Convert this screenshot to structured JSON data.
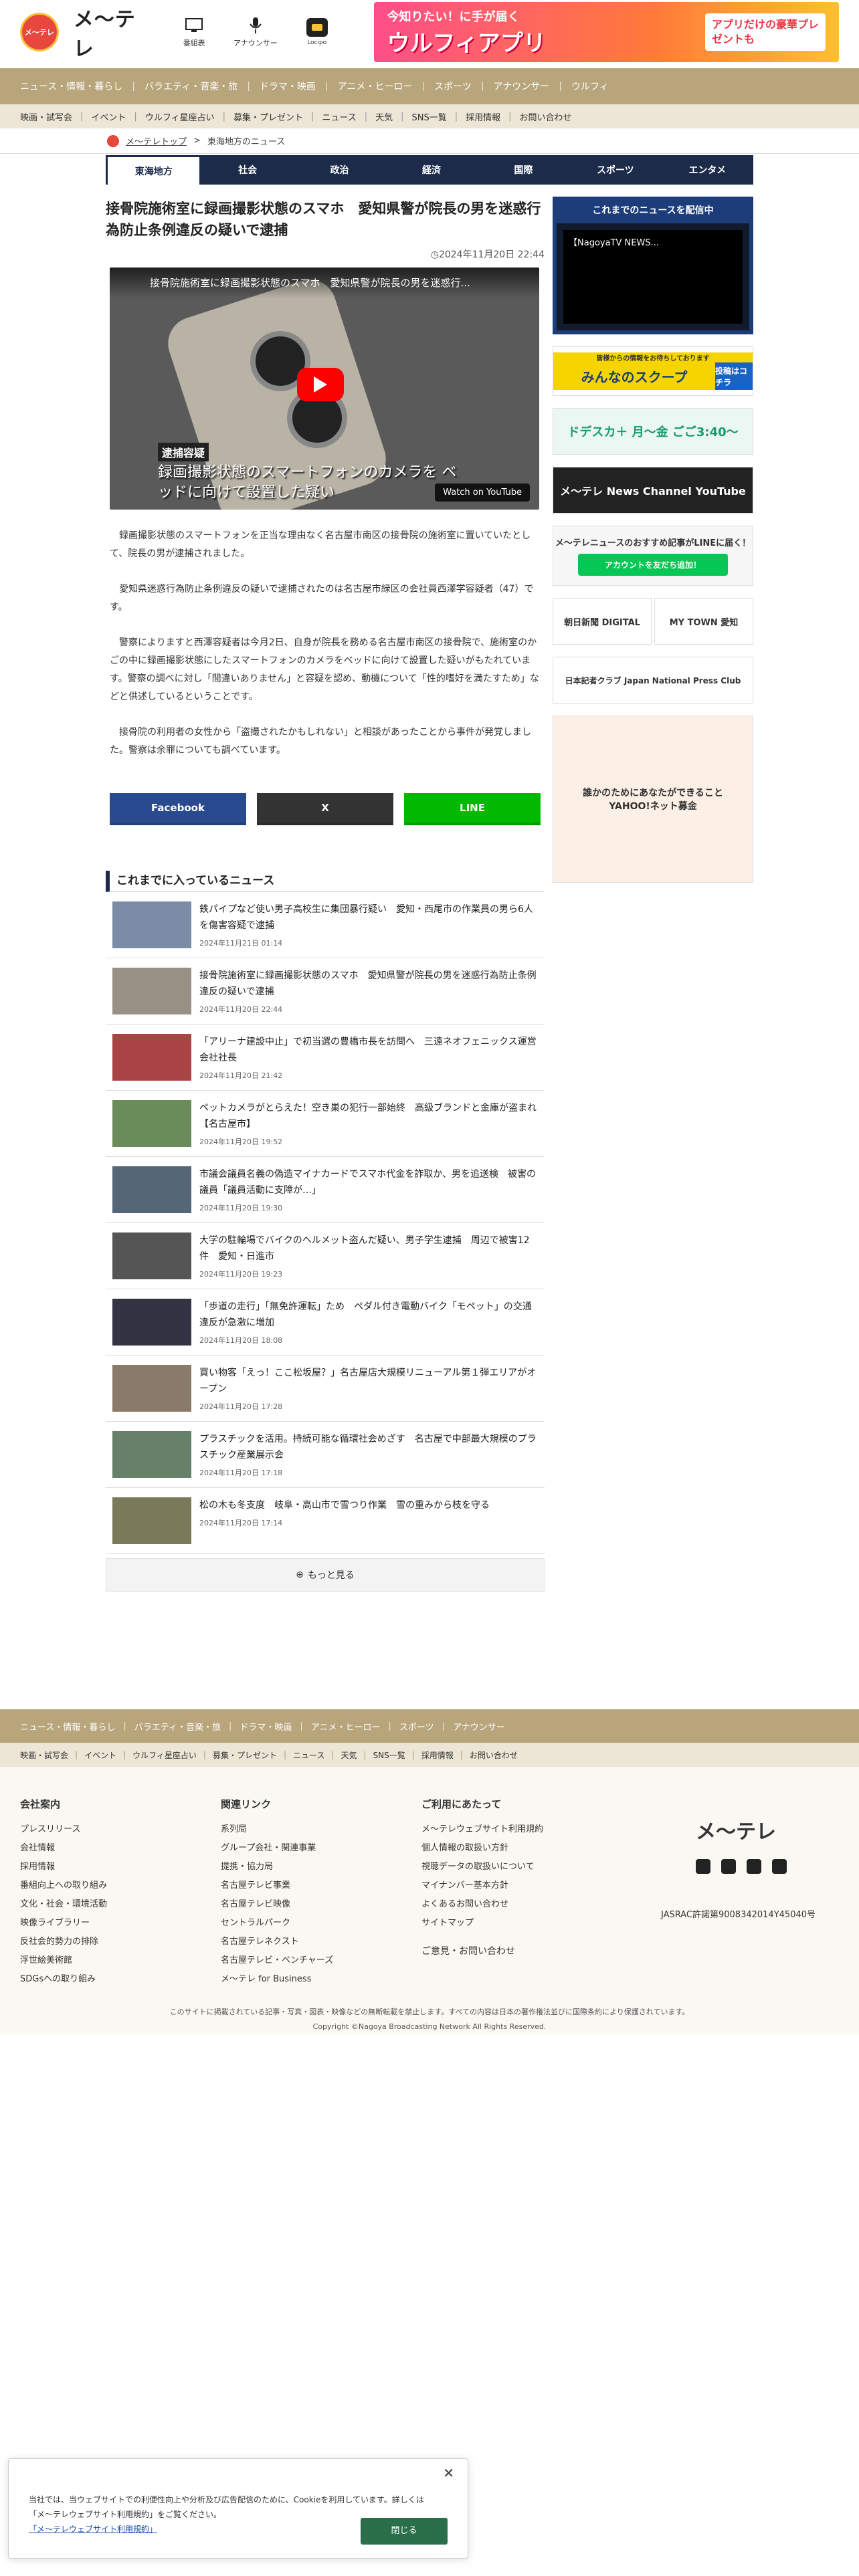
{
  "header": {
    "logo_char": "メ〜テレ",
    "logo_text": "メ〜テレ",
    "icons": [
      {
        "label": "番組表",
        "icon": "tv-icon"
      },
      {
        "label": "アナウンサー",
        "icon": "microphone-icon"
      },
      {
        "label": "Locipo",
        "icon": "locipo-icon"
      }
    ],
    "banner": {
      "line1": "今知りたい！に手が届く",
      "line2": "ウルフィアプリ",
      "line3": "アプリだけの豪華プレゼントも"
    }
  },
  "nav1": [
    "ニュース・情報・暮らし",
    "バラエティ・音楽・旅",
    "ドラマ・映画",
    "アニメ・ヒーロー",
    "スポーツ",
    "アナウンサー",
    "ウルフィ"
  ],
  "nav2": [
    "映画・試写会",
    "イベント",
    "ウルフィ星座占い",
    "募集・プレゼント",
    "ニュース",
    "天気",
    "SNS一覧",
    "採用情報",
    "お問い合わせ"
  ],
  "breadcrumb": {
    "home": "メ〜テレトップ",
    "current": "東海地方のニュース"
  },
  "categories": [
    "東海地方",
    "社会",
    "政治",
    "経済",
    "国際",
    "スポーツ",
    "エンタメ"
  ],
  "article": {
    "title": "接骨院施術室に録画撮影状態のスマホ　愛知県警が院長の男を迷惑行為防止条例違反の疑いで逮捕",
    "date": "2024年11月20日 22:44",
    "video": {
      "title": "接骨院施術室に録画撮影状態のスマホ　愛知県警が院長の男を迷惑行...",
      "label": "逮捕容疑",
      "caption": "録画撮影状態のスマートフォンのカメラを ベッドに向けて設置した疑い",
      "watch_on": "Watch on YouTube"
    },
    "paragraphs": [
      "録画撮影状態のスマートフォンを正当な理由なく名古屋市南区の接骨院の施術室に置いていたとして、院長の男が逮捕されました。",
      "愛知県迷惑行為防止条例違反の疑いで逮捕されたのは名古屋市緑区の会社員西澤学容疑者（47）です。",
      "警察によりますと西澤容疑者は今月2日、自身が院長を務める名古屋市南区の接骨院で、施術室のかごの中に録画撮影状態にしたスマートフォンのカメラをベッドに向けて設置した疑いがもたれています。警察の調べに対し「間違いありません」と容疑を認め、動機について「性的嗜好を満たすため」などと供述しているということです。",
      "接骨院の利用者の女性から「盗撮されたかもしれない」と相談があったことから事件が発覚しました。警察は余罪についても調べています。"
    ],
    "share": [
      {
        "label": "Facebook",
        "color": "#2a4a8f"
      },
      {
        "label": "X",
        "color": "#333333"
      },
      {
        "label": "LINE",
        "color": "#00b900"
      }
    ]
  },
  "news_section_title": "これまでに入っているニュース",
  "news": [
    {
      "title": "鉄パイプなど使い男子高校生に集団暴行疑い　愛知・西尾市の作業員の男ら6人を傷害容疑で逮捕",
      "date": "2024年11月21日 01:14"
    },
    {
      "title": "接骨院施術室に録画撮影状態のスマホ　愛知県警が院長の男を迷惑行為防止条例違反の疑いで逮捕",
      "date": "2024年11月20日 22:44"
    },
    {
      "title": "「アリーナ建設中止」で初当選の豊橋市長を訪問へ　三遠ネオフェニックス運営会社社長",
      "date": "2024年11月20日 21:42"
    },
    {
      "title": "ペットカメラがとらえた！空き巣の犯行一部始終　高級ブランドと金庫が盗まれ【名古屋市】",
      "date": "2024年11月20日 19:52"
    },
    {
      "title": "市議会議員名義の偽造マイナカードでスマホ代金を詐取か、男を追送検　被害の議員「議員活動に支障が…」",
      "date": "2024年11月20日 19:30"
    },
    {
      "title": "大学の駐輪場でバイクのヘルメット盗んだ疑い、男子学生逮捕　周辺で被害12件　愛知・日進市",
      "date": "2024年11月20日 19:23"
    },
    {
      "title": "「歩道の走行」「無免許運転」ため　ペダル付き電動バイク「モペット」の交通違反が急激に増加",
      "date": "2024年11月20日 18:08"
    },
    {
      "title": "買い物客「えっ！ここ松坂屋？」名古屋店大規模リニューアル第１弾エリアがオープン",
      "date": "2024年11月20日 17:28"
    },
    {
      "title": "プラスチックを活用。持続可能な循環社会めざす　名古屋で中部最大規模のプラスチック産業展示会",
      "date": "2024年11月20日 17:18"
    },
    {
      "title": "松の木も冬支度　岐阜・高山市で雪つり作業　雪の重みから枝を守る",
      "date": "2024年11月20日 17:14"
    }
  ],
  "more_label": "もっと見る",
  "sidebar": {
    "box_title": "これまでのニュースを配信中",
    "box_video": "【NagoyaTV NEWS...",
    "banners": [
      "みんなのスクープ",
      "ドデスカ＋ 月〜金 ごご3:40〜",
      "メ〜テレ News Channel YouTube",
      "メ〜テレニュースのおすすめ記事がLINEに届く！",
      "朝日新聞 DIGITAL",
      "MY TOWN 愛知",
      "日本記者クラブ Japan National Press Club",
      "誰かのためにあなたができること YAHOO!ネット募金"
    ],
    "line_button": "アカウントを友だち追加！",
    "scoop_sub": "投稿はコチラ",
    "scoop_top": "皆様からの情報をお待ちしております"
  },
  "footer": {
    "nav1": [
      "ニュース・情報・暮らし",
      "バラエティ・音楽・旅",
      "ドラマ・映画",
      "アニメ・ヒーロー",
      "スポーツ",
      "アナウンサー"
    ],
    "nav2": [
      "映画・試写会",
      "イベント",
      "ウルフィ星座占い",
      "募集・プレゼント",
      "ニュース",
      "天気",
      "SNS一覧",
      "採用情報",
      "お問い合わせ"
    ],
    "col1_title": "会社案内",
    "col1": [
      "プレスリリース",
      "会社情報",
      "採用情報",
      "番組向上への取り組み",
      "文化・社会・環境活動",
      "映像ライブラリー",
      "反社会的勢力の排除",
      "浮世絵美術館",
      "SDGsへの取り組み"
    ],
    "col2_title": "関連リンク",
    "col2": [
      "系列局",
      "グループ会社・関連事業",
      "提携・協力局",
      "名古屋テレビ事業",
      "名古屋テレビ映像",
      "セントラルパーク",
      "名古屋テレネクスト",
      "名古屋テレビ・ベンチャーズ",
      "メ〜テレ for Business"
    ],
    "col3_title": "ご利用にあたって",
    "col3": [
      "メ〜テレウェブサイト利用規約",
      "個人情報の取扱い方針",
      "視聴データの取扱いについて",
      "マイナンバー基本方針",
      "よくあるお問い合わせ",
      "サイトマップ"
    ],
    "contact": "ご意見・お問い合わせ",
    "logo": "メ〜テレ",
    "jasrac": "JASRAC許諾第9008342014Y45040号",
    "notice": "このサイトに掲載されている記事・写真・図表・映像などの無断転載を禁止します。すべての内容は日本の著作権法並びに国際条約により保護されています。",
    "copyright": "Copyright ©Nagoya Broadcasting Network All Rights Reserved."
  },
  "cookie": {
    "text1": "当社では、当ウェブサイトでの利便性向上や分析及び広告配信のために、Cookieを利用しています。詳しくは「メ〜テレウェブサイト利用規約」をご覧ください。",
    "link": "「メ〜テレウェブサイト利用規約」",
    "button": "閉じる"
  }
}
